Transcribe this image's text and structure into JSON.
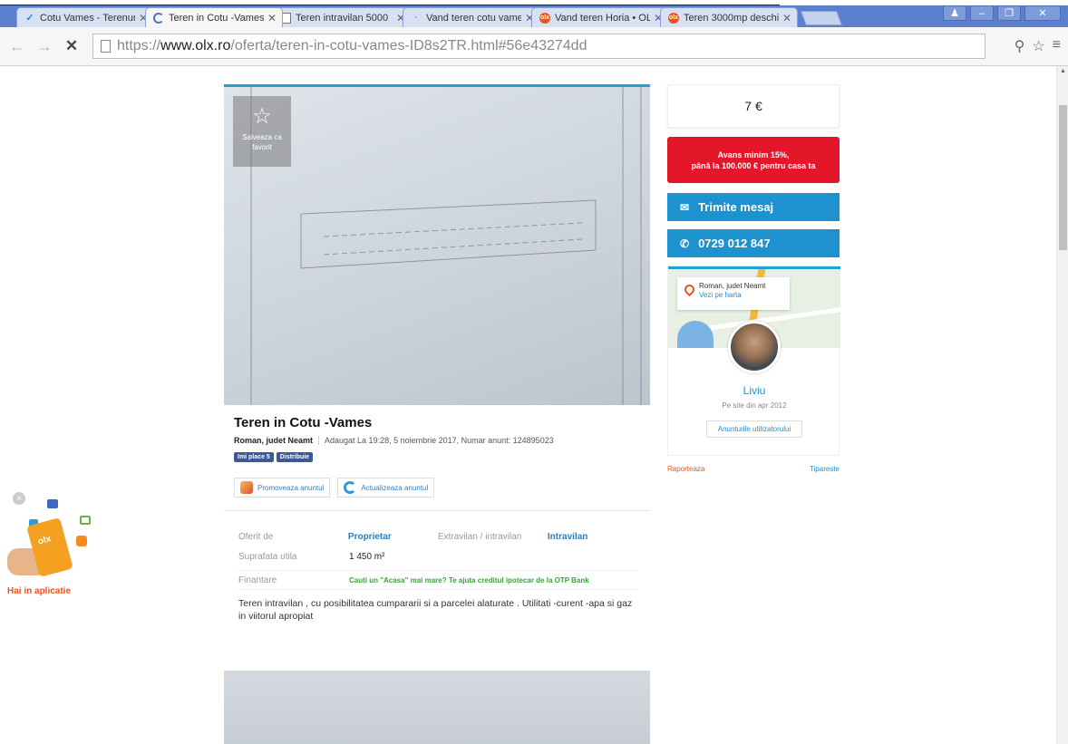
{
  "browser": {
    "tabs": [
      {
        "title": "Cotu Vames - Terenuri",
        "icon": "bird-icon"
      },
      {
        "title": "Teren in Cotu -Vames",
        "icon": "spinner-icon",
        "active": true
      },
      {
        "title": "Teren intravilan 5000",
        "icon": "page-icon"
      },
      {
        "title": "Vand teren cotu vame",
        "icon": "dot-icon"
      },
      {
        "title": "Vand teren Horia • OL",
        "icon": "olx-icon"
      },
      {
        "title": "Teren 3000mp deschi",
        "icon": "olx-icon"
      }
    ],
    "url_host": "www.olx.ro",
    "url_prefix": "https://",
    "url_path": "/oferta/teren-in-cotu-vames-ID8s2TR.html#56e43274dd",
    "favicon_text": "olx"
  },
  "listing": {
    "favorite_label": "Salveaza ca favorit",
    "title": "Teren in Cotu -Vames",
    "location": "Roman, judet Neamt",
    "added": "Adaugat La 19:28, 5 noiembrie 2017, Numar anunt: 124895023",
    "like_label": "Imi place 5",
    "share_label": "Distribuie",
    "promote_label": "Promoveaza anuntul",
    "refresh_label": "Actualizeaza anuntul",
    "details": {
      "offered_by_label": "Oferit de",
      "offered_by_value": "Proprietar",
      "zone_label": "Extravilan / intravilan",
      "zone_value": "Intravilan",
      "area_label": "Suprafata utila",
      "area_value": "1 450 m²",
      "finance_label": "Finantare",
      "finance_value": "Cauti un \"Acasa\" mai mare? Te ajuta creditul ipotecar de la OTP Bank"
    },
    "description": "Teren intravilan , cu posibilitatea cumpararii si a parcelei alaturate . Utilitati -curent -apa si gaz in viitorul apropiat"
  },
  "sidebar": {
    "price": "7 €",
    "promo_line1": "Avans minim 15%,",
    "promo_line2": "până la 100.000 € pentru casa ta",
    "message_label": "Trimite mesaj",
    "phone_label": "0729 012 847",
    "map_location": "Roman, judet Neamt",
    "map_link": "Vezi pe harta",
    "seller_name": "Liviu",
    "seller_since": "Pe site din apr 2012",
    "user_ads_label": "Anunturile utilizatorului",
    "report_label": "Raporteaza",
    "print_label": "Tipareste"
  },
  "app_promo": {
    "label": "Hai in aplicatie",
    "phone_text": "olx"
  },
  "colors": {
    "accent": "#1e91cf",
    "promo_red": "#e3162a",
    "olx_orange": "#e8531e"
  }
}
